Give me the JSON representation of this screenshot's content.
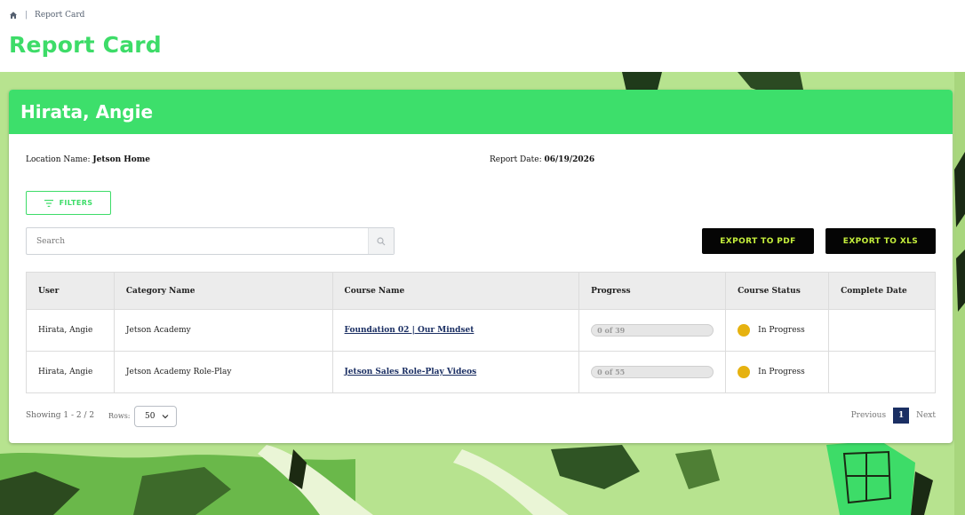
{
  "breadcrumb": {
    "home_icon": "home-icon",
    "current": "Report Card"
  },
  "page": {
    "title": "Report Card"
  },
  "student": {
    "name": "Hirata, Angie"
  },
  "meta": {
    "location_label": "Location Name:",
    "location_value": "Jetson Home",
    "report_date_label": "Report Date:",
    "report_date_value": "06/19/2026"
  },
  "toolbar": {
    "filters_label": "FILTERS",
    "search_placeholder": "Search",
    "export_pdf_label": "EXPORT TO PDF",
    "export_xls_label": "EXPORT TO XLS"
  },
  "table": {
    "headers": [
      "User",
      "Category Name",
      "Course Name",
      "Progress",
      "Course Status",
      "Complete Date"
    ],
    "rows": [
      {
        "user": "Hirata, Angie",
        "category": "Jetson Academy",
        "course": "Foundation 02 | Our Mindset",
        "progress_text": "0 of 39",
        "progress_fraction": 0,
        "status": "In Progress",
        "complete_date": ""
      },
      {
        "user": "Hirata, Angie",
        "category": "Jetson Academy Role-Play",
        "course": "Jetson Sales Role-Play Videos",
        "progress_text": "0 of 55",
        "progress_fraction": 0,
        "status": "In Progress",
        "complete_date": ""
      }
    ]
  },
  "footer": {
    "showing": "Showing 1 - 2 / 2",
    "rows_label": "Rows:",
    "rows_value": "50",
    "previous_label": "Previous",
    "current_page": "1",
    "next_label": "Next"
  },
  "colors": {
    "brand_green": "#3ddc68",
    "export_text": "#c6f03c",
    "status_in_progress": "#e6b210",
    "link": "#1b2f63"
  }
}
